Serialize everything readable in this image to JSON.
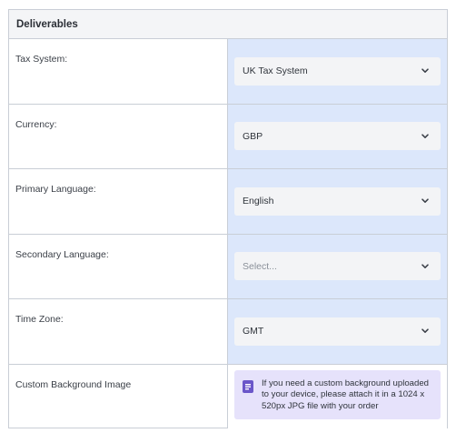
{
  "panel": {
    "title": "Deliverables"
  },
  "fields": [
    {
      "label": "Tax System:",
      "value": "UK Tax System",
      "is_placeholder": false
    },
    {
      "label": "Currency:",
      "value": "GBP",
      "is_placeholder": false
    },
    {
      "label": "Primary Language:",
      "value": "English",
      "is_placeholder": false
    },
    {
      "label": "Secondary Language:",
      "value": "Select...",
      "is_placeholder": true
    },
    {
      "label": "Time Zone:",
      "value": "GMT",
      "is_placeholder": false
    }
  ],
  "custom_background": {
    "label": "Custom Background Image",
    "notice_text": "If you need a custom background uploaded to your device, please attach it in a 1024 x 520px JPG file with your order",
    "icon": "document-icon"
  },
  "colors": {
    "value_cell_bg": "#dce7fb",
    "notice_bg": "#e6e2fb",
    "notice_icon": "#6a56c9",
    "border": "#c9ced6"
  }
}
